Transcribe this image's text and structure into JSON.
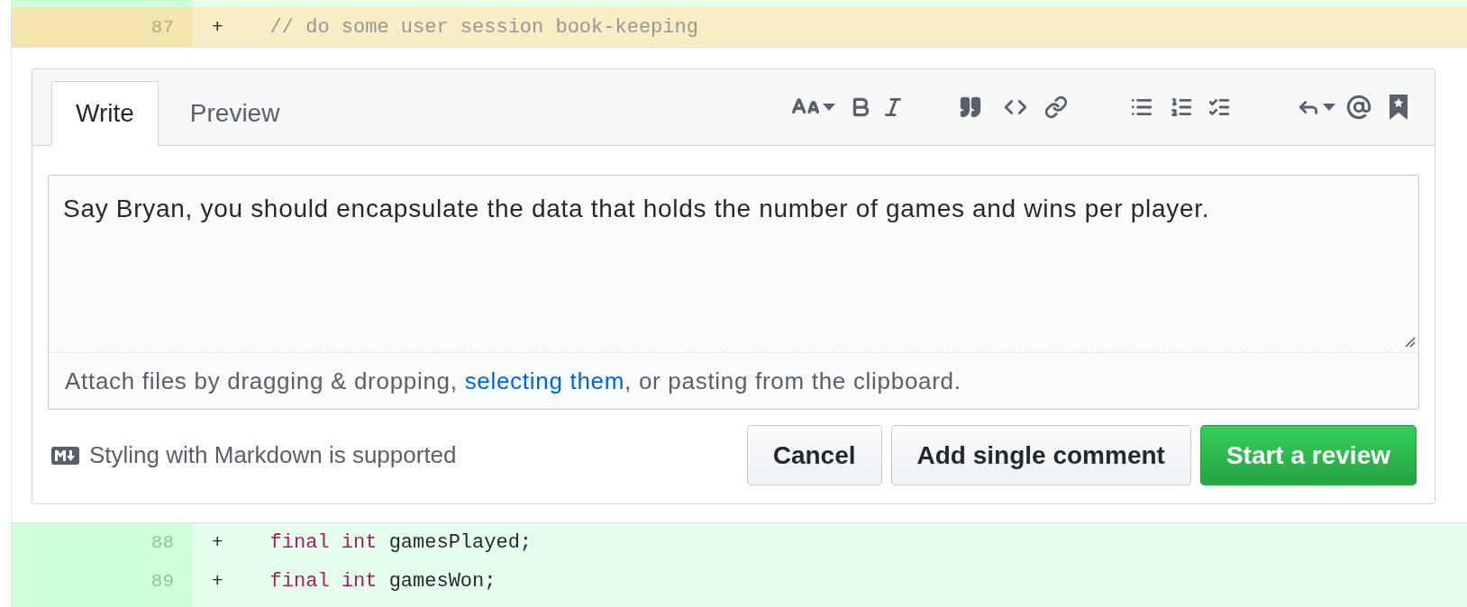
{
  "diff_before": [
    {
      "kind": "added",
      "highlighted": false
    },
    {
      "kind": "added",
      "highlighted": true,
      "line_number": "87",
      "marker": "+",
      "tokens": [
        {
          "kind": "comment",
          "text": "// do some user session book-keeping"
        }
      ]
    }
  ],
  "comment_form": {
    "tabs": [
      {
        "label": "Write",
        "selected": true
      },
      {
        "label": "Preview",
        "selected": false
      }
    ],
    "input": {
      "value": "Say Bryan, you should encapsulate the data that holds the number of games and wins per player."
    },
    "attach_hint": {
      "text_before": "Attach files by dragging & dropping,",
      "link": "selecting them",
      "text_after": ", or pasting from the clipboard."
    },
    "markdown_note": "Styling with Markdown is supported",
    "buttons": [
      {
        "label": "Cancel",
        "kind": "secondary"
      },
      {
        "label": "Add single comment",
        "kind": "secondary"
      },
      {
        "label": "Start a review",
        "kind": "primary"
      }
    ]
  },
  "diff_after": [
    {
      "kind": "added",
      "highlighted": false,
      "line_number": "88",
      "marker": "+",
      "tokens": [
        {
          "kind": "keyword",
          "text": "final"
        },
        {
          "kind": "keyword",
          "text": "int"
        },
        {
          "kind": "plain",
          "text": "gamesPlayed;"
        }
      ]
    },
    {
      "kind": "added",
      "highlighted": false,
      "line_number": "89",
      "marker": "+",
      "tokens": [
        {
          "kind": "keyword",
          "text": "final"
        },
        {
          "kind": "keyword",
          "text": "int"
        },
        {
          "kind": "plain",
          "text": "gamesWon;"
        }
      ]
    },
    {
      "kind": "added",
      "highlighted": false
    }
  ]
}
